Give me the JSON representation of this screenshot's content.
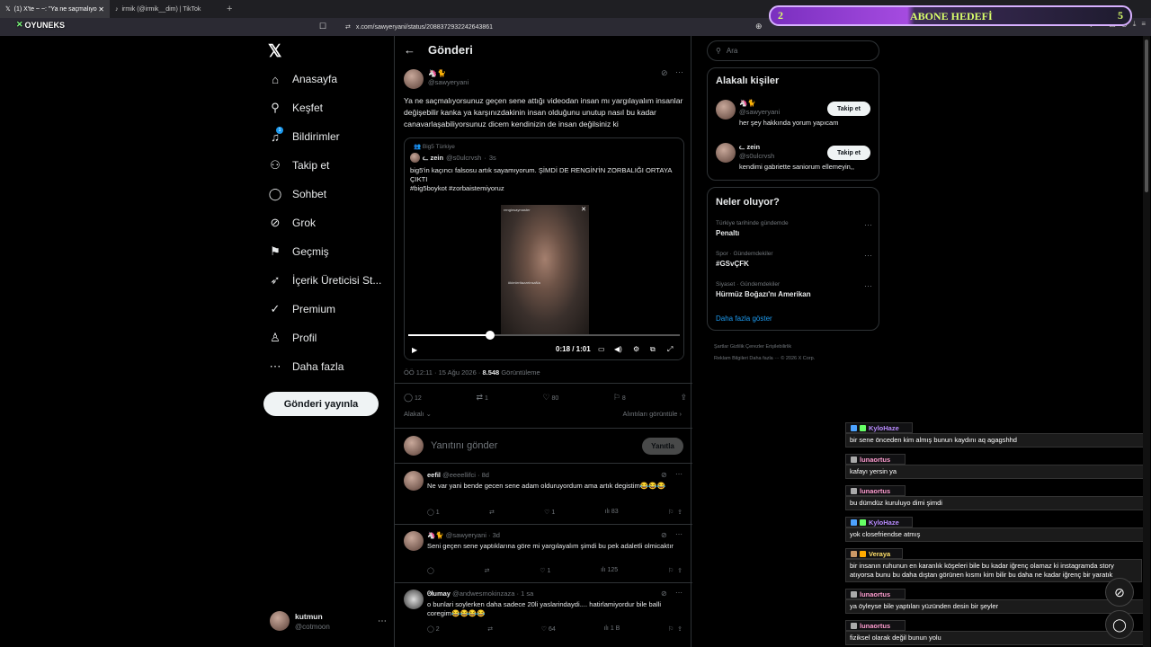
{
  "browser": {
    "tabs": [
      {
        "label": "(1) X'te ~ ~: \"Ya ne saçmalıyo",
        "active": true
      },
      {
        "label": "irmik (@irmik__dim) | TikTok",
        "active": false
      }
    ],
    "url": "x.com/sawyeryani/status/2088372932242643861",
    "logo_text": "OYUNEKS"
  },
  "goal_overlay": {
    "left_num": "2",
    "title": "ABONE HEDEFİ",
    "right_num": "5"
  },
  "nav": {
    "items": [
      "Anasayfa",
      "Keşfet",
      "Bildirimler",
      "Takip et",
      "Sohbet",
      "Grok",
      "Geçmiş",
      "İçerik Üreticisi St...",
      "Premium",
      "Profil",
      "Daha fazla"
    ],
    "notif_badge": "1",
    "post_button": "Gönderi yayınla",
    "me_name": "kutmun",
    "me_handle": "@cotmoon"
  },
  "main": {
    "header": "Gönderi",
    "author_name": "🦄🐈",
    "author_handle": "@sawyeryani",
    "text": "Ya ne saçmalıyorsunuz geçen sene attığı videodan insan mı yargılayalım insanlar değişebilir kanka ya karşınızdakinin insan olduğunu unutup nasıl bu kadar canavarlaşabiliyorsunuz dicem kendinizin de insan değilsiniz ki",
    "quote": {
      "community": "Big5 Türkiye",
      "name": "ᓚ zein",
      "handle": "@s0ulcrvsh",
      "time": "3s",
      "text": "big5'in kaçıncı falsosu artık sayamıyorum. ŞİMDİ DE RENGİN'İN ZORBALIĞI ORTAYA ÇIKTI",
      "tags": "#big5boykot #zorbaistemiyoruz",
      "video_user": "renginsaymaster",
      "video_caption": "#kimleritazzeinsaNa",
      "video_time": "0:18 / 1:01",
      "progress": 0.3
    },
    "meta_time": "ÖÖ 12:11 · 15 Ağu 2026",
    "views": "8.548",
    "views_label": "Görüntüleme",
    "counts": {
      "replies": "12",
      "reposts": "1",
      "likes": "80",
      "bookmarks": "8"
    },
    "related": "Alakalı",
    "quotes_link": "Alıntıları görüntüle",
    "reply_placeholder": "Yanıtını gönder",
    "reply_button": "Yanıtla",
    "replies": [
      {
        "name": "eefil",
        "handle": "@eeeellifci",
        "time": "8d",
        "text": "Ne var yani bende gecen sene adam olduruyordum ama artık degistim😂😂😂",
        "r": "1",
        "rt": "",
        "l": "1",
        "v": "83"
      },
      {
        "name": "🦄🐈",
        "handle": "@sawyeryani",
        "time": "3d",
        "text": "Seni geçen sene yaptıklarına göre mi yargılayalım şimdi bu pek adaletli olmicaktır",
        "r": "",
        "rt": "",
        "l": "1",
        "v": "125"
      },
      {
        "name": "ᘛumay",
        "handle": "@andwesmokinzaza",
        "time": "1 sa",
        "text": "o bunlari soylerken daha sadece 20li yaslarindaydi.... hatirlamiyordur bile balli coregim😂😂😂😂",
        "r": "2",
        "rt": "",
        "l": "64",
        "v": "1 B"
      }
    ]
  },
  "right": {
    "search_placeholder": "Ara",
    "people_title": "Alakalı kişiler",
    "people": [
      {
        "name": "🦄🐈",
        "handle": "@sawyeryani",
        "bio": "her şey hakkında yorum yapıcam",
        "btn": "Takip et"
      },
      {
        "name": "ᓚ zein",
        "handle": "@s0ulcrvsh",
        "bio": "kendimi gabriette saniorum ellemeyin,,",
        "btn": "Takip et"
      }
    ],
    "trends_title": "Neler oluyor?",
    "trends": [
      {
        "meta": "Türkiye tarihinde gündemde",
        "name": "Penaltı"
      },
      {
        "meta": "Spor · Gündemdekiler",
        "name": "#GSvÇFK"
      },
      {
        "meta": "Siyaset · Gündemdekiler",
        "name": "Hürmüz Boğazı'nı Amerikan"
      }
    ],
    "show_more": "Daha fazla göster",
    "footer_line1": "Şartlar    Gizlilik    Çerezler    Erişilebilirlik",
    "footer_line2": "Reklam Bilgileri    Daha fazla ···   © 2026 X Corp."
  },
  "chat": [
    {
      "user": "KyloHaze",
      "color": "#b98cff",
      "text": "bir sene önceden kim almış bunun kaydını aq agagshhd"
    },
    {
      "user": "lunaortus",
      "color": "#ff9ccf",
      "text": "kafayı yersin ya"
    },
    {
      "user": "lunaortus",
      "color": "#ff9ccf",
      "text": "bu dümdüz kuruluyo dimi şimdi"
    },
    {
      "user": "KyloHaze",
      "color": "#b98cff",
      "text": "yok closefriendse atmış"
    },
    {
      "user": "Veraya",
      "color": "#ffe06a",
      "text": "bir insanın ruhunun en karanlık köşeleri bile bu kadar iğrenç olamaz ki instagramda story atıyorsa bunu bu daha dıştan görünen kısmı kim bilir bu daha ne kadar iğrenç bir yaratık"
    },
    {
      "user": "lunaortus",
      "color": "#ff9ccf",
      "text": "ya öyleyse bile yaptıları yüzünden desin bir şeyler"
    },
    {
      "user": "lunaortus",
      "color": "#ff9ccf",
      "text": "fiziksel olarak değil bunun yolu"
    }
  ]
}
